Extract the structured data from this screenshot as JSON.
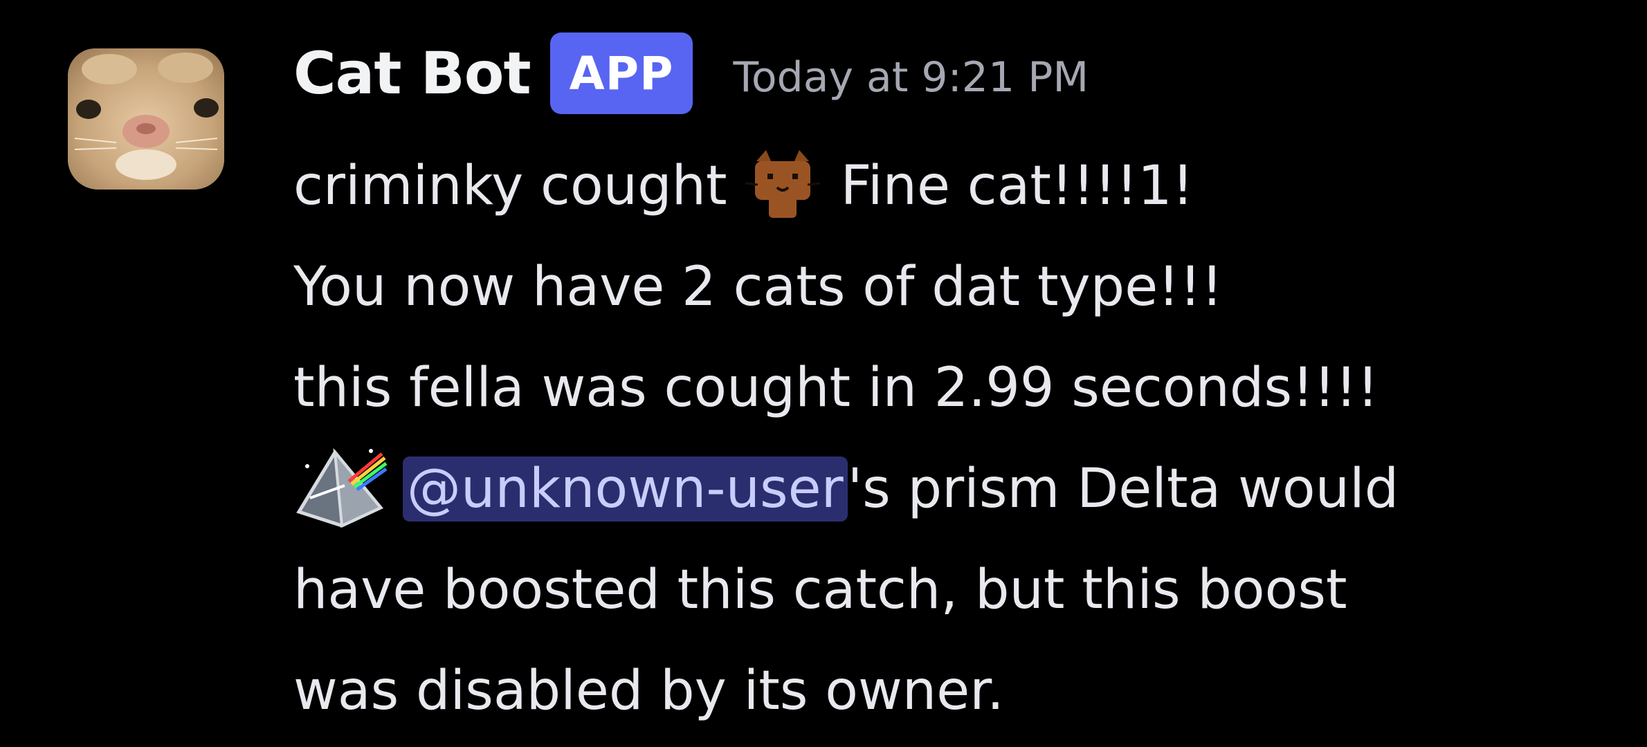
{
  "message": {
    "author": {
      "name": "Cat Bot",
      "badge": "APP",
      "avatar_icon": "cat-face-avatar"
    },
    "timestamp": "Today at 9:21 PM",
    "lines": {
      "line1_before": "criminky cought",
      "line1_emoji": "fine-cat-emoji",
      "line1_after": "Fine cat!!!!1!",
      "line2": "You now have 2 cats of dat type!!!",
      "line3": "this fella was cought in 2.99 seconds!!!!",
      "line4_emoji": "prism-emoji",
      "line4_mention": "@unknown-user",
      "line4_after": "'s prism Delta would",
      "line5": "have boosted this catch, but this boost",
      "line6": "was disabled by its owner."
    }
  },
  "colors": {
    "background": "#000000",
    "badge": "#5865f2",
    "mention_bg": "#2b2e6e",
    "mention_text": "#c9cdfb",
    "timestamp": "#a5a8b2",
    "text": "#e8e9ee"
  }
}
